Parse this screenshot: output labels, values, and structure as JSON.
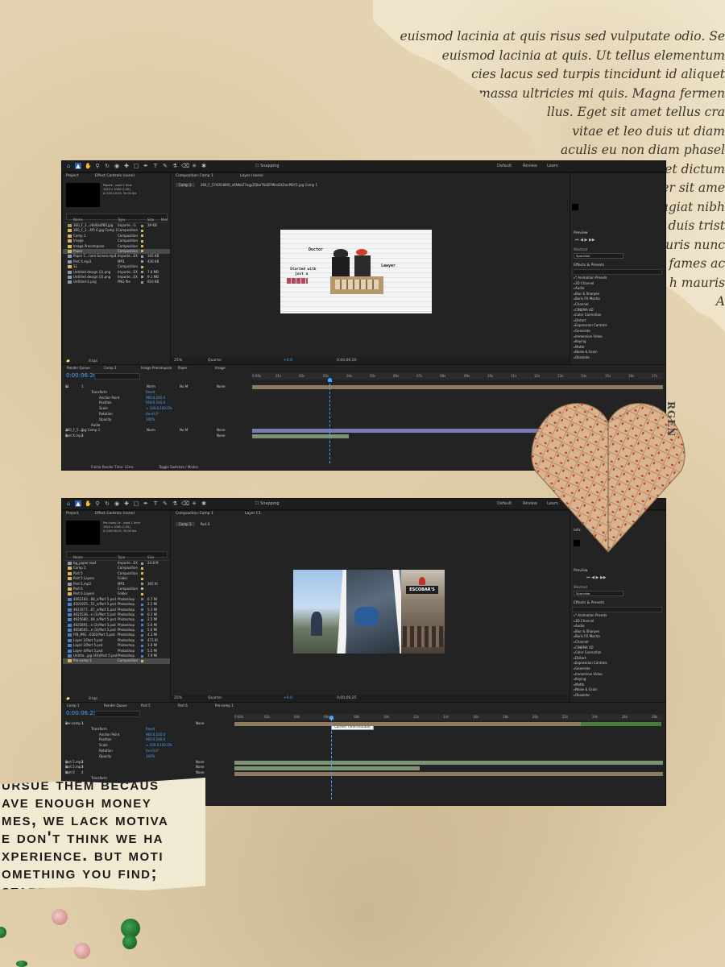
{
  "collage": {
    "torn_paper_lines": [
      "euismod lacinia at quis risus sed vulputate odio. Se",
      "euismod lacinia at quis. Ut tellus elementum",
      "cies lacus sed turpis tincidunt id aliquet",
      "massa ultricies mi quis. Magna fermen",
      "llus. Eget sit amet tellus cra",
      "vitae et leo duis ut diam",
      "aculis eu non diam phasel",
      "Cursus sit amet dictum",
      "llamcorper sit ame",
      "semper feugiat nibh",
      "ing elit duis trist",
      "t mauris nunc",
      "la fames ac",
      "h mauris",
      "A"
    ],
    "heart_map_text": "RGEN",
    "note_lines": [
      "ursue them becaus",
      "ave enough money",
      "mes, we lack motiva",
      "e don't think we ha",
      "xperience. but moti",
      "omething you find;",
      "        starts wi"
    ]
  },
  "screen1": {
    "toolbar": {
      "snapping": "Snapping",
      "workspaces": [
        "Default",
        "Review",
        "Learn"
      ]
    },
    "project_panel": {
      "tabs": [
        "Project",
        "Effect Controls (none)"
      ],
      "footage_info": [
        "Paper▾ , used 1 time",
        "1920 x 1080 (1.00)",
        "Δ 0;00;10;00, 30.00 fps"
      ],
      "columns": [
        "Name",
        "Type",
        "Size",
        "Med"
      ],
      "items": [
        {
          "name": "360_F_3...e0d0a4f80.jpg",
          "type": "Importe...G",
          "size": "39 KB",
          "color": "#a09a6b",
          "icon": "image-icon"
        },
        {
          "name": "360_F_1...4f5 6.jpg Comp 1",
          "type": "Composition",
          "size": "",
          "color": "#d9b65c",
          "icon": "composition-icon"
        },
        {
          "name": "Comp 1",
          "type": "Composition",
          "size": "",
          "color": "#d9b65c",
          "icon": "composition-icon"
        },
        {
          "name": "Image",
          "type": "Composition",
          "size": "",
          "color": "#d9b65c",
          "icon": "composition-icon"
        },
        {
          "name": "Image Precompose",
          "type": "Composition",
          "size": "",
          "color": "#d9b65c",
          "icon": "composition-icon"
        },
        {
          "name": "Paper",
          "type": "Composition",
          "size": "",
          "color": "#d9b65c",
          "icon": "composition-icon",
          "selected": true
        },
        {
          "name": "Paper C...nom Screen.mp4",
          "type": "Importe...EX",
          "size": "105 KB",
          "color": "#8c9ab0",
          "icon": "footage-icon"
        },
        {
          "name": "Part X.mp3",
          "type": "MP3",
          "size": "430 KB",
          "color": "#8c9ab0",
          "icon": "audio-icon"
        },
        {
          "name": "S1",
          "type": "Composition",
          "size": "",
          "color": "#d9b65c",
          "icon": "composition-icon"
        },
        {
          "name": "Untitled design (2).png",
          "type": "Importe...EX",
          "size": "7.8 MB",
          "color": "#8c9ab0",
          "icon": "image-icon"
        },
        {
          "name": "Untitled design (3).png",
          "type": "Importe...EX",
          "size": "9.1 MB",
          "color": "#8c9ab0",
          "icon": "image-icon"
        },
        {
          "name": "Untitled-1.png",
          "type": "PNG file",
          "size": "816 KB",
          "color": "#8c9ab0",
          "icon": "image-icon"
        }
      ],
      "footer_bpc": "8 bpc"
    },
    "composition": {
      "tabs": [
        "Composition Comp 1",
        "Layer (none)"
      ],
      "breadcrumb": [
        "Comp 1",
        "360_F_574054806_n6NKeZ7egyZQbeT6dZFMbnD4ZenPBiY1.jpg Comp 1"
      ],
      "frame_text": {
        "doctor": "Doctor",
        "lawyer": "Lawyer",
        "started": "Started with",
        "just": "just a"
      },
      "zoom": "25%",
      "resolution": "Quarter",
      "timecode": "0;00;06;20",
      "plus": "+0.0"
    },
    "right_panel": {
      "preview": "Preview",
      "shortcut": "Shortcut",
      "shortcut_value": "Spacebar",
      "effects_title": "Effects & Presets",
      "effects": [
        "* Animation Presets",
        "3D Channel",
        "Audio",
        "Blur & Sharpen",
        "Boris FX Mocha",
        "Channel",
        "CINEMA 4D",
        "Color Correction",
        "Distort",
        "Expression Controls",
        "Generate",
        "Immersive Video",
        "Keying",
        "Matte",
        "Noise & Grain",
        "Obsolete"
      ]
    },
    "timeline": {
      "tabs": [
        "Render Queue",
        "Comp 1",
        "Image Precompose",
        "Paper",
        "Image"
      ],
      "timecode": "0:00:06:20",
      "ruler_ticks": [
        "0:00s",
        "01s",
        "02s",
        "03s",
        "04s",
        "05s",
        "06s",
        "07s",
        "08s",
        "09s",
        "10s",
        "11s",
        "12s",
        "13s",
        "14s",
        "15s",
        "16s",
        "17s"
      ],
      "columns": [
        "#",
        "Source Name",
        "Mode",
        "T",
        "TrkMat",
        "Parent & Link"
      ],
      "layers": [
        {
          "num": "1",
          "name": "S1",
          "mode": "Norm",
          "trk": "No M",
          "parent": "None",
          "kind": "layer"
        },
        {
          "num": "",
          "name": "Transform",
          "mode": "",
          "trk": "",
          "parent": "",
          "kind": "group",
          "value": "Reset"
        },
        {
          "num": "",
          "name": "Anchor Point",
          "value": "960.0,540.0",
          "kind": "prop"
        },
        {
          "num": "",
          "name": "Position",
          "value": "959.6,540.0",
          "kind": "prop"
        },
        {
          "num": "",
          "name": "Scale",
          "value": "∞ 100.0,100.0%",
          "kind": "prop"
        },
        {
          "num": "",
          "name": "Rotation",
          "value": "0x+0.0°",
          "kind": "prop"
        },
        {
          "num": "",
          "name": "Opacity",
          "value": "100%",
          "kind": "prop"
        },
        {
          "num": "",
          "name": "Audio",
          "value": "",
          "kind": "group"
        },
        {
          "num": "2",
          "name": "360_F_5...jpg Comp 1",
          "mode": "Norm",
          "trk": "No M",
          "parent": "None",
          "kind": "layer"
        },
        {
          "num": "3",
          "name": "Part X.mp3",
          "mode": "",
          "trk": "",
          "parent": "None",
          "kind": "layer"
        }
      ],
      "footer": [
        "Frame Render Time: 12ms",
        "Toggle Switches / Modes"
      ]
    }
  },
  "screen2": {
    "toolbar": {
      "snapping": "Snapping",
      "workspaces": [
        "Default",
        "Review",
        "Learn"
      ]
    },
    "project_panel": {
      "tabs": [
        "Project",
        "Effect Controls (none)"
      ],
      "footage_info": [
        "Pre-comp 1▾ , used 1 time",
        "1920 x 1080 (1.00)",
        "Δ 0;00;06;25, 30.00 fps"
      ],
      "columns": [
        "Name",
        "Type",
        "Size"
      ],
      "items": [
        {
          "name": "bg_paper.mp4",
          "type": "Importe...EX",
          "size": "24.8 M",
          "color": "#8c9ab0",
          "icon": "footage-icon"
        },
        {
          "name": "Comp 2",
          "type": "Composition",
          "size": "",
          "color": "#d9b65c",
          "icon": "composition-icon"
        },
        {
          "name": "Part 5",
          "type": "Composition",
          "size": "",
          "color": "#d9b65c",
          "icon": "composition-icon"
        },
        {
          "name": "Part 5 Layers",
          "type": "Folder",
          "size": "",
          "color": "#d9b65c",
          "icon": "folder-icon"
        },
        {
          "name": "Part 5.mp3",
          "type": "MP3",
          "size": "365 KI",
          "color": "#8c9ab0",
          "icon": "audio-icon"
        },
        {
          "name": "Part 6",
          "type": "Composition",
          "size": "",
          "color": "#d9b65c",
          "icon": "composition-icon"
        },
        {
          "name": "Part 6 Layers",
          "type": "Folder",
          "size": "",
          "color": "#d9b65c",
          "icon": "folder-icon"
        },
        {
          "name": "4062162...68_n/Part 5.psd",
          "type": "Photoshop",
          "size": "6.7 MI",
          "color": "#4d7fc4",
          "icon": "photoshop-icon"
        },
        {
          "name": "4501925...51_n/Part 5.psd",
          "type": "Photoshop",
          "size": "2.5 MI",
          "color": "#4d7fc4",
          "icon": "photoshop-icon"
        },
        {
          "name": "4611677...67_n/Part 5.psd",
          "type": "Photoshop",
          "size": "5.3 MI",
          "color": "#4d7fc4",
          "icon": "photoshop-icon"
        },
        {
          "name": "4625536...n (1)/Part 5.psd",
          "type": "Photoshop",
          "size": "6.1 MI",
          "color": "#4d7fc4",
          "icon": "photoshop-icon"
        },
        {
          "name": "4625680...69_n/Part 5.psd",
          "type": "Photoshop",
          "size": "2.5 MI",
          "color": "#4d7fc4",
          "icon": "photoshop-icon"
        },
        {
          "name": "4625891...n (2)/Part 5.psd",
          "type": "Photoshop",
          "size": "5.6 MI",
          "color": "#4d7fc4",
          "icon": "photoshop-icon"
        },
        {
          "name": "4658505...n (3)/Part 5.psd",
          "type": "Photoshop",
          "size": "5.6 MI",
          "color": "#4d7fc4",
          "icon": "photoshop-icon"
        },
        {
          "name": "IYB_IMG...0302/Part 5.psd",
          "type": "Photoshop",
          "size": "4.3 MI",
          "color": "#4d7fc4",
          "icon": "photoshop-icon"
        },
        {
          "name": "Layer 1/Part 5.psd",
          "type": "Photoshop",
          "size": "472 KI",
          "color": "#4d7fc4",
          "icon": "photoshop-icon"
        },
        {
          "name": "Layer 2/Part 5.psd",
          "type": "Photoshop",
          "size": "1.6 MI",
          "color": "#4d7fc4",
          "icon": "photoshop-icon"
        },
        {
          "name": "Layer 4/Part 5.psd",
          "type": "Photoshop",
          "size": "5.5 MI",
          "color": "#4d7fc4",
          "icon": "photoshop-icon"
        },
        {
          "name": "Untitle...jpg (40)/Part 5.psd",
          "type": "Photoshop",
          "size": "7.9 MI",
          "color": "#4d7fc4",
          "icon": "photoshop-icon"
        },
        {
          "name": "Pre-comp 1",
          "type": "Composition",
          "size": "",
          "color": "#d9b65c",
          "icon": "composition-icon",
          "selected": true
        }
      ],
      "footer_bpc": "8 bpc"
    },
    "composition": {
      "tabs": [
        "Composition Comp 1",
        "Layer C1"
      ],
      "breadcrumb": [
        "Comp 1",
        "Part 6"
      ],
      "frame_text": {
        "sign": "ESCOBAR'S"
      },
      "zoom": "25%",
      "resolution": "Quarter",
      "timecode": "0;00;06;25",
      "plus": "+0.0"
    },
    "right_panel": {
      "properties": "Properties",
      "info": "Info",
      "preview": "Preview",
      "shortcut": "Shortcut",
      "shortcut_value": "Spacebar",
      "effects_title": "Effects & Presets",
      "effects": [
        "* Animation Presets",
        "3D Channel",
        "Audio",
        "Blur & Sharpen",
        "Boris FX Mocha",
        "Channel",
        "CINEMA 4D",
        "Color Correction",
        "Distort",
        "Expression Controls",
        "Generate",
        "Immersive Video",
        "Keying",
        "Matte",
        "Noise & Grain",
        "Obsolete"
      ]
    },
    "timeline": {
      "tabs": [
        "Comp 1",
        "Render Queue",
        "Part 5",
        "Part 6",
        "Pre-comp 1"
      ],
      "timecode": "0:00:06:25",
      "ruler_ticks": [
        "0:00s",
        "02s",
        "04s",
        "06s",
        "08s",
        "10s",
        "12s",
        "14s",
        "16s",
        "18s",
        "20s",
        "22s",
        "24s",
        "26s",
        "28s"
      ],
      "tooltip": "Current Time Indicator",
      "columns": [
        "#",
        "Source Name",
        "Parent & Link"
      ],
      "layers": [
        {
          "num": "1",
          "name": "Pre-comp 1",
          "parent": "None",
          "kind": "layer"
        },
        {
          "num": "",
          "name": "Transform",
          "value": "Reset",
          "kind": "group"
        },
        {
          "num": "",
          "name": "Anchor Point",
          "value": "960.0,540.0",
          "kind": "prop"
        },
        {
          "num": "",
          "name": "Position",
          "value": "960.0,540.0",
          "kind": "prop"
        },
        {
          "num": "",
          "name": "Scale",
          "value": "∞ 100.0,100.0%",
          "kind": "prop"
        },
        {
          "num": "",
          "name": "Rotation",
          "value": "0x+0.0°",
          "kind": "prop"
        },
        {
          "num": "",
          "name": "Opacity",
          "value": "100%",
          "kind": "prop"
        },
        {
          "num": "2",
          "name": "Part 5.mp3",
          "parent": "None",
          "kind": "layer"
        },
        {
          "num": "3",
          "name": "Part 5.mp3",
          "parent": "None",
          "kind": "layer"
        },
        {
          "num": "4",
          "name": "Part 6",
          "parent": "None",
          "kind": "layer"
        },
        {
          "num": "",
          "name": "Transform",
          "value": "",
          "kind": "group"
        }
      ]
    }
  },
  "colors": {
    "accent_blue": "#4da3ff",
    "ae_panel": "#232323",
    "bar_purple": "#7a7ab6",
    "bar_green": "#7c9474",
    "bar_tan": "#8c7b5e"
  }
}
